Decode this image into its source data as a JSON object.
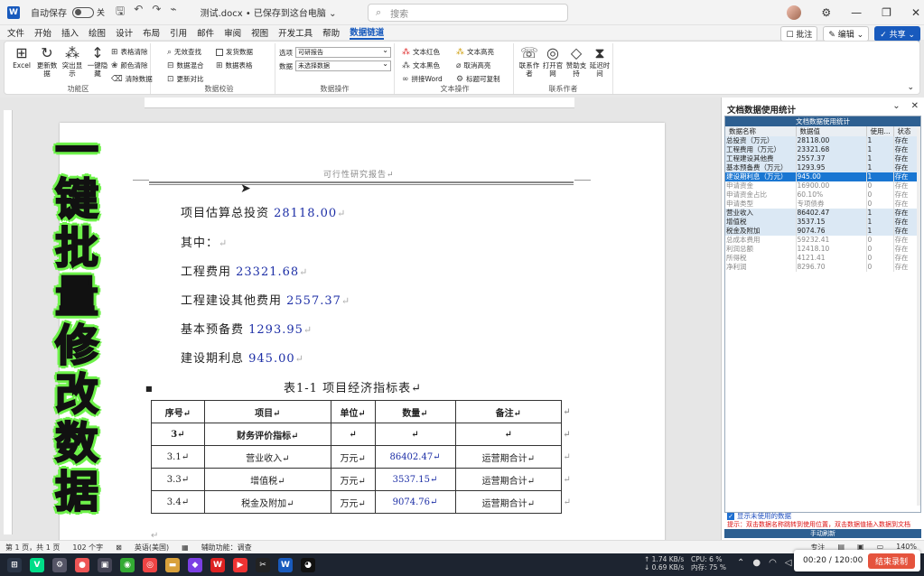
{
  "titlebar": {
    "logo": "W",
    "autosave_label": "自动保存",
    "autosave_state": "关",
    "doc_title": "测试.docx • 已保存到这台电脑 ⌄",
    "search_placeholder": "搜索"
  },
  "menu": {
    "tabs": [
      "文件",
      "开始",
      "插入",
      "绘图",
      "设计",
      "布局",
      "引用",
      "邮件",
      "审阅",
      "视图",
      "开发工具",
      "帮助",
      "数据链道"
    ],
    "active_index": 12,
    "comment_btn": "☐ 批注",
    "edit_btn": "✎ 编辑 ⌄",
    "share_btn": "✓ 共享 ⌄"
  },
  "ribbon": {
    "group1": {
      "name": "功能区",
      "buttons": [
        {
          "icon": "⊞",
          "label": "Excel"
        },
        {
          "icon": "↻",
          "label": "更新数据"
        },
        {
          "icon": "⁂",
          "label": "突出显示"
        },
        {
          "icon": "↕",
          "label": "一键隐藏"
        }
      ],
      "small": [
        "表格清除",
        "颜色清除",
        "清除数据"
      ]
    },
    "group2": {
      "name": "数据校验",
      "small": [
        "无效查找",
        "数据混合",
        "更新对比",
        "发货数据",
        "数据表格"
      ]
    },
    "group3": {
      "name": "数据操作",
      "combo1_label": "选项",
      "combo1_value": "可研报告",
      "combo2_label": "数据",
      "combo2_value": "未选择数据"
    },
    "group4": {
      "name": "文本操作",
      "small": [
        "文本红色",
        "文本高亮",
        "文本黑色",
        "取消高亮",
        "拼接Word",
        "标题可复制"
      ]
    },
    "group5": {
      "name": "联系作者",
      "buttons": [
        {
          "icon": "☏",
          "label": "联系作者"
        },
        {
          "icon": "◎",
          "label": "打开官网"
        },
        {
          "icon": "◇",
          "label": "赞助支持"
        },
        {
          "icon": "⧗",
          "label": "延迟时间"
        }
      ]
    }
  },
  "document": {
    "header": "可行性研究报告↵",
    "lines": [
      {
        "text": "项目估算总投资 ",
        "value": "28118.00"
      },
      {
        "text": "其中：",
        "value": ""
      },
      {
        "text": "工程费用 ",
        "value": "23321.68"
      },
      {
        "text": "工程建设其他费用 ",
        "value": "2557.37"
      },
      {
        "text": "基本预备费 ",
        "value": "1293.95"
      },
      {
        "text": "建设期利息 ",
        "value": "945.00"
      }
    ],
    "para_mark": "↵",
    "table_caption": "表1-1  项目经济指标表↵",
    "table": {
      "headers": [
        "序号↵",
        "项目↵",
        "单位↵",
        "数量↵",
        "备注↵"
      ],
      "rows": [
        [
          "3↵",
          "财务评价指标↵",
          "↵",
          "↵",
          "↵"
        ],
        [
          "3.1↵",
          "营业收入↵",
          "万元↵",
          "86402.47↵",
          "运营期合计↵"
        ],
        [
          "3.3↵",
          "增值税↵",
          "万元↵",
          "3537.15↵",
          "运营期合计↵"
        ],
        [
          "3.4↵",
          "税金及附加↵",
          "万元↵",
          "9074.76↵",
          "运营期合计↵"
        ]
      ]
    }
  },
  "overlay": {
    "chars": [
      "一",
      "键",
      "批",
      "量",
      "修",
      "改",
      "数",
      "据"
    ]
  },
  "panel": {
    "title": "文档数据使用统计",
    "inner_title": "文档数据使用统计",
    "columns": [
      "数据名称",
      "数据值",
      "使用...",
      "状态"
    ],
    "rows": [
      {
        "name": "总投资（万元）",
        "value": "28118.00",
        "count": "1",
        "status": "存在",
        "kind": "used"
      },
      {
        "name": "工程费用（万元）",
        "value": "23321.68",
        "count": "1",
        "status": "存在",
        "kind": "used"
      },
      {
        "name": "工程建设其他费",
        "value": "2557.37",
        "count": "1",
        "status": "存在",
        "kind": "used"
      },
      {
        "name": "基本预备费（万元）",
        "value": "1293.95",
        "count": "1",
        "status": "存在",
        "kind": "used"
      },
      {
        "name": "建设期利息（万元）",
        "value": "945.00",
        "count": "1",
        "status": "存在",
        "kind": "sel"
      },
      {
        "name": "申请资金",
        "value": "16900.00",
        "count": "0",
        "status": "存在",
        "kind": "unused"
      },
      {
        "name": "申请资金占比",
        "value": "60.10%",
        "count": "0",
        "status": "存在",
        "kind": "unused"
      },
      {
        "name": "申请类型",
        "value": "专项债券",
        "count": "0",
        "status": "存在",
        "kind": "unused"
      },
      {
        "name": "营业收入",
        "value": "86402.47",
        "count": "1",
        "status": "存在",
        "kind": "used"
      },
      {
        "name": "增值税",
        "value": "3537.15",
        "count": "1",
        "status": "存在",
        "kind": "used"
      },
      {
        "name": "税金及附加",
        "value": "9074.76",
        "count": "1",
        "status": "存在",
        "kind": "used"
      },
      {
        "name": "总成本费用",
        "value": "59232.41",
        "count": "0",
        "status": "存在",
        "kind": "unused"
      },
      {
        "name": "利润总额",
        "value": "12418.10",
        "count": "0",
        "status": "存在",
        "kind": "unused"
      },
      {
        "name": "所得税",
        "value": "4121.41",
        "count": "0",
        "status": "存在",
        "kind": "unused"
      },
      {
        "name": "净利润",
        "value": "8296.70",
        "count": "0",
        "status": "存在",
        "kind": "unused"
      }
    ],
    "show_unused": "显示未使用的数据",
    "hint": "提示：双击数据名称跳转到使用位置，双击数据值插入数据到文档",
    "footer_btn": "手动刷新"
  },
  "statusbar": {
    "page": "第 1 页，共 1 页",
    "words": "102 个字",
    "lang": "英语(美国)",
    "access": "辅助功能：调查",
    "focus": "专注",
    "zoom": "140%"
  },
  "taskbar": {
    "net_up": "↑ 1.74 KB/s",
    "net_down": "↓ 0.69 KB/s",
    "cpu": "CPU: 6 %",
    "mem": "内存: 75 %",
    "rec_time": "00:20 / 120:00",
    "rec_stop": "结束录制"
  }
}
